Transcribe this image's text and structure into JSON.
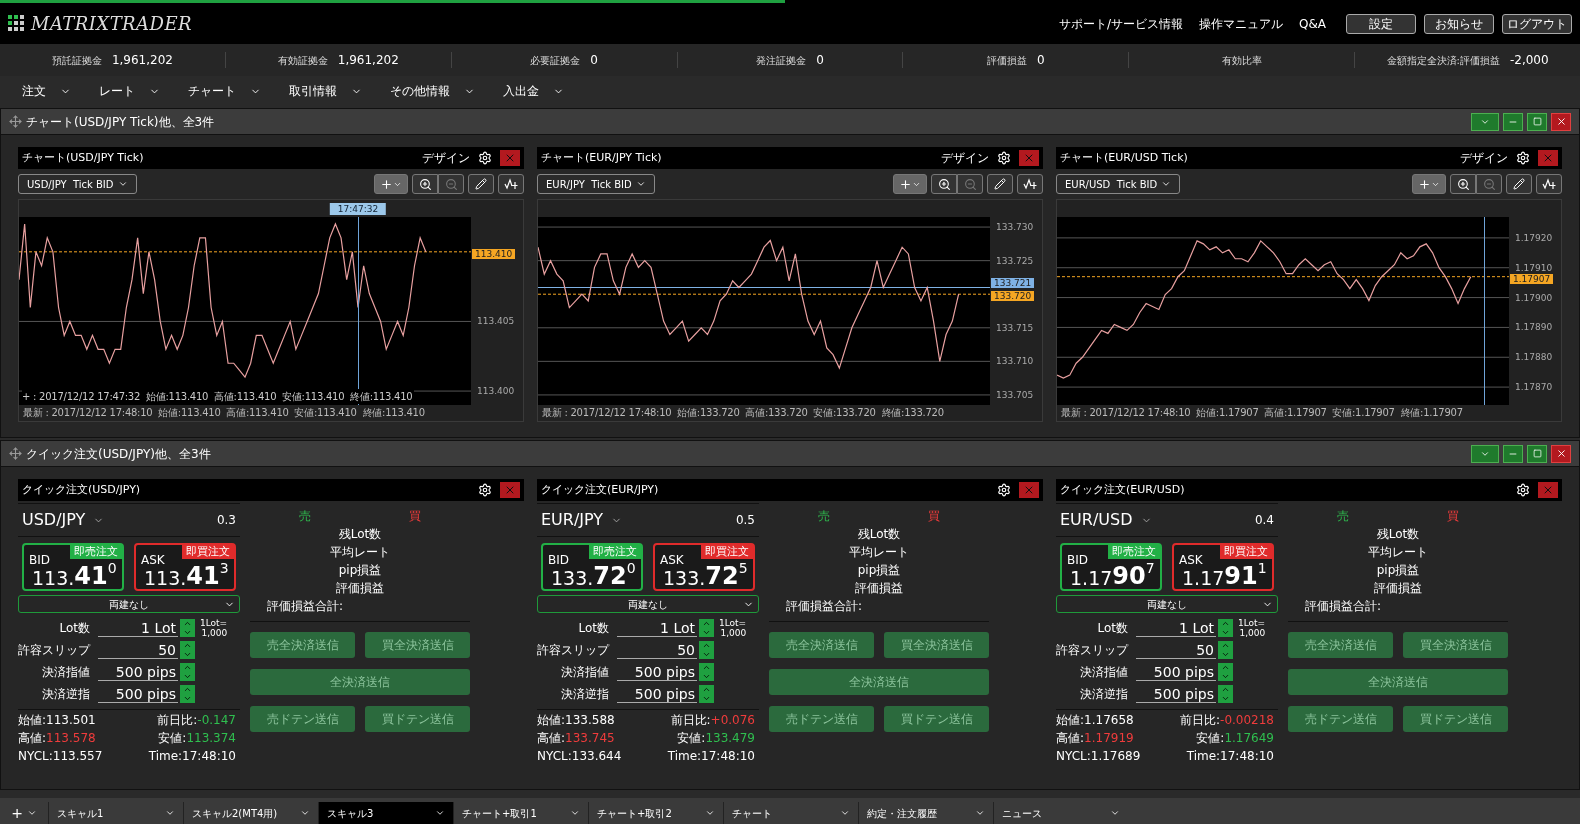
{
  "app": {
    "logo": "MATRIXTRADER"
  },
  "header_links": [
    "サポート/サービス情報",
    "操作マニュアル",
    "Q&A"
  ],
  "header_buttons": [
    "設定",
    "お知らせ",
    "ログアウト"
  ],
  "account": [
    {
      "label": "預託証拠金",
      "value": "1,961,202"
    },
    {
      "label": "有効証拠金",
      "value": "1,961,202"
    },
    {
      "label": "必要証拠金",
      "value": "0"
    },
    {
      "label": "発注証拠金",
      "value": "0"
    },
    {
      "label": "評価損益",
      "value": "0"
    },
    {
      "label": "有効比率"
    },
    {
      "label": "金額指定全決済:評価損益",
      "value": "-2,000"
    }
  ],
  "menu": [
    "注文",
    "レート",
    "チャート",
    "取引情報",
    "その他情報",
    "入出金"
  ],
  "chart_panel": {
    "title": "チャート(USD/JPY Tick)他、全3件",
    "charts": [
      {
        "title": "チャート(USD/JPY Tick)",
        "design": "デザイン",
        "symbol": "USD/JPY  Tick BID",
        "cursor_line": true,
        "cursor_time": "17:47:32",
        "cursor_info": "+ : 2017/12/12 17:47:32  始値:113.410  高値:113.410  安値:113.410  終値:113.410",
        "footer": "最新 : 2017/12/12 17:48:10  始値:113.410  高値:113.410  安値:113.410  終値:113.410",
        "chart_data": {
          "type": "line",
          "ylim": [
            113.399,
            113.4125
          ],
          "yticks": [
            {
              "value": 113.405,
              "label": "113.405"
            },
            {
              "value": 113.4,
              "label": "113.400"
            }
          ],
          "grid": true,
          "ref_lines": [
            {
              "axis": "y",
              "value": 113.41,
              "label": "113.410",
              "color": "#f5a623"
            }
          ],
          "series": [
            {
              "color": "#e8a0a0",
              "values": [
                113.408,
                113.412,
                113.406,
                113.41,
                113.409,
                113.411,
                113.41,
                113.406,
                113.404,
                113.405,
                113.404,
                113.404,
                113.403,
                113.404,
                113.403,
                113.403,
                113.402,
                113.403,
                113.403,
                113.406,
                113.408,
                113.411,
                113.407,
                113.41,
                113.408,
                113.405,
                113.403,
                113.404,
                113.403,
                113.404,
                113.406,
                113.409,
                113.411,
                113.411,
                113.406,
                113.404,
                113.405,
                113.402,
                113.402,
                113.4015,
                113.401,
                113.402,
                113.404,
                113.404,
                113.403,
                113.402,
                113.403,
                113.404,
                113.405,
                113.403,
                113.404,
                113.405,
                113.406,
                113.407,
                113.409,
                113.411,
                113.412,
                113.411,
                113.408,
                113.41,
                113.406,
                113.409,
                113.407,
                113.406,
                113.405,
                113.403,
                113.404,
                113.405,
                113.404,
                113.406,
                113.409,
                113.411,
                113.41,
                null,
                null,
                null,
                null,
                null,
                null,
                null,
                null
              ]
            }
          ]
        }
      },
      {
        "title": "チャート(EUR/JPY Tick)",
        "design": "デザイン",
        "symbol": "EUR/JPY  Tick BID",
        "cursor_line": false,
        "footer": "最新 : 2017/12/12 17:48:10  始値:133.720  高値:133.720  安値:133.720  終値:133.720",
        "chart_data": {
          "type": "line",
          "ylim": [
            133.7035,
            133.7315
          ],
          "yticks": [
            {
              "value": 133.73,
              "label": "133.730"
            },
            {
              "value": 133.725,
              "label": "133.725"
            },
            {
              "value": 133.715,
              "label": "133.715"
            },
            {
              "value": 133.71,
              "label": "133.710"
            },
            {
              "value": 133.705,
              "label": "133.705"
            }
          ],
          "grid": true,
          "ref_lines": [
            {
              "axis": "y",
              "value": 133.721,
              "label": "133.721",
              "color": "#7fb2e5"
            },
            {
              "axis": "y",
              "value": 133.72,
              "label": "133.720",
              "color": "#f5a623"
            }
          ],
          "series": [
            {
              "color": "#e8a0a0",
              "values": [
                133.727,
                133.723,
                133.725,
                133.723,
                133.722,
                133.718,
                133.719,
                133.72,
                133.719,
                133.724,
                133.726,
                133.726,
                133.722,
                133.72,
                133.724,
                133.726,
                133.724,
                133.725,
                133.724,
                133.72,
                133.716,
                133.714,
                133.715,
                133.716,
                133.713,
                133.714,
                133.715,
                133.714,
                133.716,
                133.719,
                133.72,
                133.722,
                133.721,
                133.722,
                133.723,
                133.725,
                133.727,
                133.728,
                133.725,
                133.727,
                133.722,
                133.726,
                133.72,
                133.716,
                133.714,
                133.716,
                133.712,
                133.711,
                133.709,
                133.712,
                133.715,
                133.717,
                133.719,
                133.721,
                133.725,
                133.721,
                133.723,
                133.725,
                133.727,
                133.726,
                133.721,
                133.719,
                133.721,
                133.716,
                133.71,
                133.714,
                133.716,
                133.72,
                null,
                null,
                null,
                null,
                null
              ]
            }
          ]
        }
      },
      {
        "title": "チャート(EUR/USD Tick)",
        "design": "デザイン",
        "symbol": "EUR/USD  Tick BID",
        "cursor_line": true,
        "footer": "最新 : 2017/12/12 17:48:10  始値:1.17907  高値:1.17907  安値:1.17907  終値:1.17907",
        "chart_data": {
          "type": "line",
          "ylim": [
            1.17864,
            1.17927
          ],
          "yticks": [
            {
              "value": 1.1792,
              "label": "1.17920"
            },
            {
              "value": 1.1791,
              "label": "1.17910"
            },
            {
              "value": 1.179,
              "label": "1.17900"
            },
            {
              "value": 1.1789,
              "label": "1.17890"
            },
            {
              "value": 1.1788,
              "label": "1.17880"
            },
            {
              "value": 1.1787,
              "label": "1.17870"
            }
          ],
          "grid": true,
          "ref_lines": [
            {
              "axis": "y",
              "value": 1.17907,
              "label": "1.17907",
              "color": "#f5a623"
            }
          ],
          "series": [
            {
              "color": "#e8a0a0",
              "values": [
                1.17874,
                1.17873,
                1.17874,
                1.17878,
                1.1788,
                1.17883,
                1.17886,
                1.17889,
                1.17888,
                1.17891,
                1.1789,
                1.17889,
                1.17891,
                1.17895,
                1.17898,
                1.17897,
                1.17896,
                1.17901,
                1.17903,
                1.17907,
                1.17909,
                1.17914,
                1.17919,
                1.17918,
                1.17916,
                1.17917,
                1.17915,
                1.17916,
                1.17913,
                1.17913,
                1.17912,
                1.17915,
                1.17919,
                1.17917,
                1.17915,
                1.17912,
                1.17908,
                1.17908,
                1.17911,
                1.17913,
                1.17911,
                1.17909,
                1.17911,
                1.17912,
                1.17908,
                1.17906,
                1.17903,
                1.17906,
                1.17903,
                1.17899,
                1.17904,
                1.17907,
                1.17909,
                1.17911,
                1.17915,
                1.17913,
                1.17914,
                1.17917,
                1.17918,
                1.17915,
                1.1791,
                1.17907,
                1.17903,
                1.17898,
                1.17903,
                1.17907,
                null,
                null,
                null,
                null,
                null,
                null
              ]
            }
          ]
        }
      }
    ]
  },
  "order_panel": {
    "title": "クイック注文(USD/JPY)他、全3件",
    "orders": [
      {
        "title": "クイック注文(USD/JPY)",
        "pair": "USD/JPY",
        "spread": "0.3",
        "bid": {
          "label": "BID",
          "button": "即売注文",
          "head": "113.",
          "big": "41",
          "sup": "0"
        },
        "ask": {
          "label": "ASK",
          "button": "即買注文",
          "head": "113.",
          "big": "41",
          "sup": "3"
        },
        "hedge": "両建なし",
        "fields": [
          {
            "label": "Lot数",
            "value": "1 Lot",
            "note": [
              "1Lot=",
              "1,000"
            ]
          },
          {
            "label": "許容スリップ",
            "value": "50"
          },
          {
            "label": "決済指値",
            "value": "500 pips"
          },
          {
            "label": "決済逆指",
            "value": "500 pips"
          }
        ],
        "sell": "売",
        "buy": "買",
        "summary": [
          "残Lot数",
          "平均レート",
          "pip損益",
          "評価損益"
        ],
        "total": "評価損益合計:",
        "actions": {
          "sell_close": "売全決済送信",
          "buy_close": "買全決済送信",
          "all_close": "全決済送信",
          "sell_doten": "売ドテン送信",
          "buy_doten": "買ドテン送信"
        },
        "stats": [
          {
            "label": "始値:",
            "value": "113.501",
            "kind": "plain"
          },
          {
            "label": "前日比:",
            "value": "-0.147",
            "kind": "down"
          },
          {
            "label": "高値:",
            "value": "113.578",
            "kind": "up"
          },
          {
            "label": "安値:",
            "value": "113.374",
            "kind": "down"
          },
          {
            "label": "NYCL:",
            "value": "113.557",
            "kind": "plain"
          },
          {
            "label": "Time:",
            "value": "17:48:10",
            "kind": "plain"
          }
        ]
      },
      {
        "title": "クイック注文(EUR/JPY)",
        "pair": "EUR/JPY",
        "spread": "0.5",
        "bid": {
          "label": "BID",
          "button": "即売注文",
          "head": "133.",
          "big": "72",
          "sup": "0"
        },
        "ask": {
          "label": "ASK",
          "button": "即買注文",
          "head": "133.",
          "big": "72",
          "sup": "5"
        },
        "hedge": "両建なし",
        "fields": [
          {
            "label": "Lot数",
            "value": "1 Lot",
            "note": [
              "1Lot=",
              "1,000"
            ]
          },
          {
            "label": "許容スリップ",
            "value": "50"
          },
          {
            "label": "決済指値",
            "value": "500 pips"
          },
          {
            "label": "決済逆指",
            "value": "500 pips"
          }
        ],
        "sell": "売",
        "buy": "買",
        "summary": [
          "残Lot数",
          "平均レート",
          "pip損益",
          "評価損益"
        ],
        "total": "評価損益合計:",
        "actions": {
          "sell_close": "売全決済送信",
          "buy_close": "買全決済送信",
          "all_close": "全決済送信",
          "sell_doten": "売ドテン送信",
          "buy_doten": "買ドテン送信"
        },
        "stats": [
          {
            "label": "始値:",
            "value": "133.588",
            "kind": "plain"
          },
          {
            "label": "前日比:",
            "value": "+0.076",
            "kind": "up"
          },
          {
            "label": "高値:",
            "value": "133.745",
            "kind": "up"
          },
          {
            "label": "安値:",
            "value": "133.479",
            "kind": "down"
          },
          {
            "label": "NYCL:",
            "value": "133.644",
            "kind": "plain"
          },
          {
            "label": "Time:",
            "value": "17:48:10",
            "kind": "plain"
          }
        ]
      },
      {
        "title": "クイック注文(EUR/USD)",
        "pair": "EUR/USD",
        "spread": "0.4",
        "bid": {
          "label": "BID",
          "button": "即売注文",
          "head": "1.17",
          "big": "90",
          "sup": "7"
        },
        "ask": {
          "label": "ASK",
          "button": "即買注文",
          "head": "1.17",
          "big": "91",
          "sup": "1"
        },
        "hedge": "両建なし",
        "fields": [
          {
            "label": "Lot数",
            "value": "1 Lot",
            "note": [
              "1Lot=",
              "1,000"
            ]
          },
          {
            "label": "許容スリップ",
            "value": "50"
          },
          {
            "label": "決済指値",
            "value": "500 pips"
          },
          {
            "label": "決済逆指",
            "value": "500 pips"
          }
        ],
        "sell": "売",
        "buy": "買",
        "summary": [
          "残Lot数",
          "平均レート",
          "pip損益",
          "評価損益"
        ],
        "total": "評価損益合計:",
        "actions": {
          "sell_close": "売全決済送信",
          "buy_close": "買全決済送信",
          "all_close": "全決済送信",
          "sell_doten": "売ドテン送信",
          "buy_doten": "買ドテン送信"
        },
        "stats": [
          {
            "label": "始値:",
            "value": "1.17658",
            "kind": "plain"
          },
          {
            "label": "前日比:",
            "value": "-0.00218",
            "kind": "up"
          },
          {
            "label": "高値:",
            "value": "1.17919",
            "kind": "up"
          },
          {
            "label": "安値:",
            "value": "1.17649",
            "kind": "down"
          },
          {
            "label": "NYCL:",
            "value": "1.17689",
            "kind": "plain"
          },
          {
            "label": "Time:",
            "value": "17:48:10",
            "kind": "plain"
          }
        ]
      }
    ]
  },
  "add_tab": "+",
  "tabs": [
    {
      "label": "スキャル1",
      "selected": false
    },
    {
      "label": "スキャル2(MT4用)",
      "selected": false
    },
    {
      "label": "スキャル3",
      "selected": true
    },
    {
      "label": "チャート+取引1",
      "selected": false
    },
    {
      "label": "チャート+取引2",
      "selected": false
    },
    {
      "label": "チャート",
      "selected": false
    },
    {
      "label": "約定・注文履歴",
      "selected": false
    },
    {
      "label": "ニュース",
      "selected": false
    }
  ]
}
